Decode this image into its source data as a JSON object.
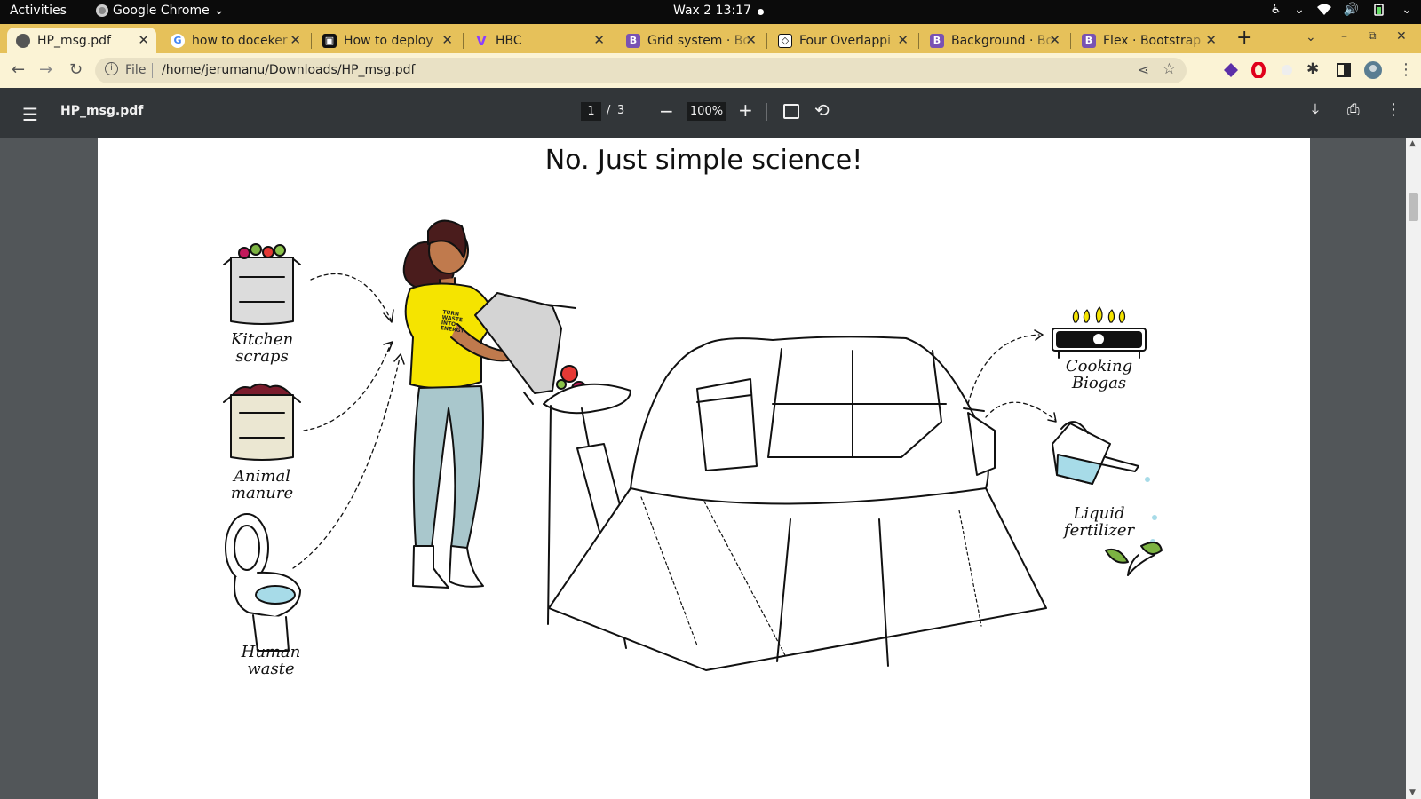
{
  "topbar": {
    "activities": "Activities",
    "app_name": "Google Chrome",
    "clock": "Wax 2  13:17"
  },
  "tabs": [
    {
      "label": "HP_msg.pdf",
      "favicon": "pdf-globe-icon",
      "active": true
    },
    {
      "label": "how to doceker",
      "favicon": "google-icon",
      "active": false
    },
    {
      "label": "How to deploy",
      "favicon": "video-icon",
      "active": false
    },
    {
      "label": "HBC",
      "favicon": "vite-icon",
      "active": false
    },
    {
      "label": "Grid system · Bo",
      "favicon": "bootstrap-icon",
      "active": false
    },
    {
      "label": "Four Overlappi",
      "favicon": "codepen-icon",
      "active": false
    },
    {
      "label": "Background · Bo",
      "favicon": "bootstrap-icon",
      "active": false
    },
    {
      "label": "Flex · Bootstrap",
      "favicon": "bootstrap-icon",
      "active": false
    }
  ],
  "omnibox": {
    "scheme": "File",
    "url": "/home/jerumanu/Downloads/HP_msg.pdf"
  },
  "pdf": {
    "filename": "HP_msg.pdf",
    "current_page": "1",
    "page_sep": "/",
    "total_pages": "3",
    "zoom": "100%"
  },
  "document": {
    "heading": "No. Just simple science!",
    "inputs": [
      {
        "line1": "Kitchen",
        "line2": "scraps"
      },
      {
        "line1": "Animal",
        "line2": "manure"
      },
      {
        "line1": "Human",
        "line2": "waste"
      }
    ],
    "outputs": [
      {
        "line1": "Cooking",
        "line2": "Biogas"
      },
      {
        "line1": "Liquid",
        "line2": "fertilizer"
      }
    ],
    "shirt_text": [
      "TURN",
      "WASTE",
      "INTO",
      "ENERGY"
    ]
  },
  "colors": {
    "tab_strip": "#e6c15a",
    "toolbar": "#fbf3d5",
    "pdf_toolbar": "#323639",
    "shirt": "#f5e400",
    "water": "#a7dbe8"
  }
}
